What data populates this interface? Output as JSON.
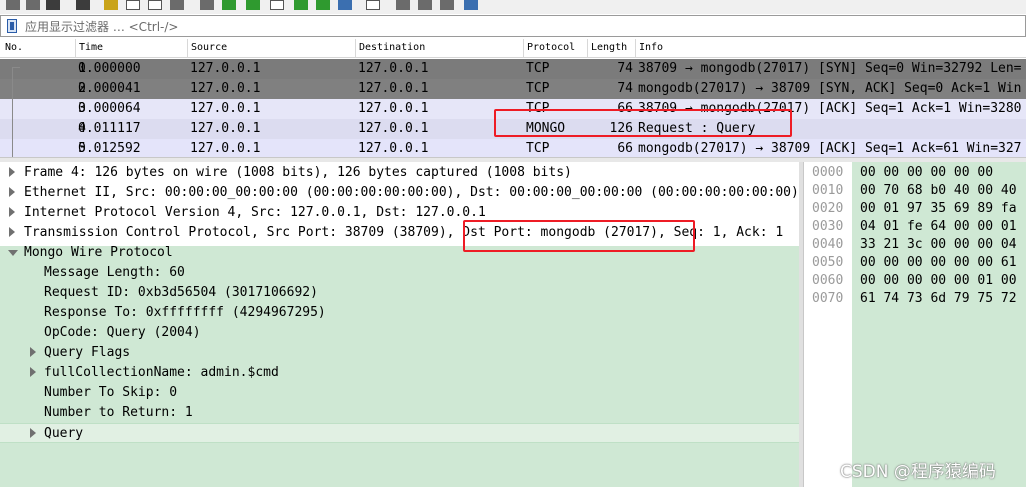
{
  "filter": {
    "placeholder": "应用显示过滤器 … <Ctrl-/>"
  },
  "packet_list": {
    "columns": [
      "No.",
      "Time",
      "Source",
      "Destination",
      "Protocol",
      "Length",
      "Info"
    ],
    "rows": [
      {
        "no": "1",
        "time": "0.000000",
        "source": "127.0.0.1",
        "destination": "127.0.0.1",
        "protocol": "TCP",
        "length": "74",
        "info": "38709 → mongodb(27017) [SYN] Seq=0 Win=32792 Len="
      },
      {
        "no": "2",
        "time": "0.000041",
        "source": "127.0.0.1",
        "destination": "127.0.0.1",
        "protocol": "TCP",
        "length": "74",
        "info": "mongodb(27017) → 38709 [SYN, ACK] Seq=0 Ack=1 Win"
      },
      {
        "no": "3",
        "time": "0.000064",
        "source": "127.0.0.1",
        "destination": "127.0.0.1",
        "protocol": "TCP",
        "length": "66",
        "info": "38709 → mongodb(27017) [ACK] Seq=1 Ack=1 Win=3280"
      },
      {
        "no": "4",
        "time": "0.011117",
        "source": "127.0.0.1",
        "destination": "127.0.0.1",
        "protocol": "MONGO",
        "length": "126",
        "info": "Request : Query"
      },
      {
        "no": "5",
        "time": "0.012592",
        "source": "127.0.0.1",
        "destination": "127.0.0.1",
        "protocol": "TCP",
        "length": "66",
        "info": "mongodb(27017) → 38709 [ACK] Seq=1 Ack=61 Win=327"
      }
    ]
  },
  "details": {
    "rows": [
      {
        "text": "Frame 4: 126 bytes on wire (1008 bits), 126 bytes captured (1008 bits)",
        "expander": "collapsed"
      },
      {
        "text": "Ethernet II, Src: 00:00:00_00:00:00 (00:00:00:00:00:00), Dst: 00:00:00_00:00:00 (00:00:00:00:00:00)",
        "expander": "collapsed"
      },
      {
        "text": "Internet Protocol Version 4, Src: 127.0.0.1, Dst: 127.0.0.1",
        "expander": "collapsed"
      },
      {
        "text": "Transmission Control Protocol, Src Port: 38709 (38709), Dst Port: mongodb (27017), Seq: 1, Ack: 1",
        "expander": "collapsed"
      },
      {
        "text": "Mongo Wire Protocol",
        "expander": "expanded"
      },
      {
        "text": "Message Length: 60",
        "expander": "none"
      },
      {
        "text": "Request ID: 0xb3d56504 (3017106692)",
        "expander": "none"
      },
      {
        "text": "Response To: 0xffffffff (4294967295)",
        "expander": "none"
      },
      {
        "text": "OpCode: Query (2004)",
        "expander": "none"
      },
      {
        "text": "Query Flags",
        "expander": "collapsed"
      },
      {
        "text": "fullCollectionName: admin.$cmd",
        "expander": "collapsed"
      },
      {
        "text": "Number To Skip: 0",
        "expander": "none"
      },
      {
        "text": "Number to Return: 1",
        "expander": "none"
      },
      {
        "text": "Query",
        "expander": "collapsed"
      }
    ]
  },
  "bytes": {
    "rows": [
      {
        "offset": "0000",
        "hex": "00 00 00 00 00 00"
      },
      {
        "offset": "0010",
        "hex": "00 70 68 b0 40 00 40"
      },
      {
        "offset": "0020",
        "hex": "00 01 97 35 69 89 fa"
      },
      {
        "offset": "0030",
        "hex": "04 01 fe 64 00 00 01"
      },
      {
        "offset": "0040",
        "hex": "33 21 3c 00 00 00 04"
      },
      {
        "offset": "0050",
        "hex": "00 00 00 00 00 00 61"
      },
      {
        "offset": "0060",
        "hex": "00 00 00 00 00 01 00"
      },
      {
        "offset": "0070",
        "hex": "61 74 73 6d 79 75 72"
      }
    ]
  },
  "watermark": "CSDN @程序猿编码",
  "colors": {
    "highlight": "#ee1c25",
    "details_green": "#cfe8d4",
    "row_dark": "#7b7b7b",
    "row_light": "#e6e6f8"
  }
}
